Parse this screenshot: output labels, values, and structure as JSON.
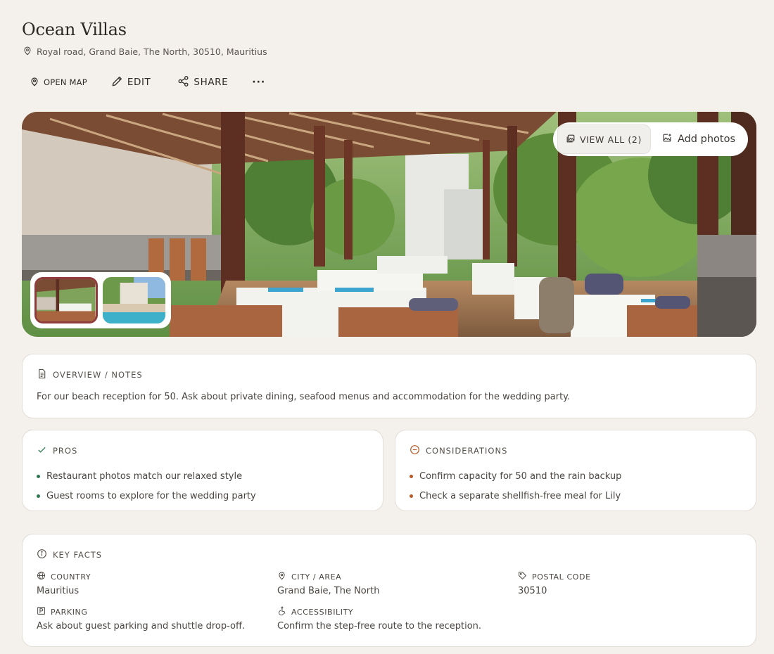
{
  "venue": {
    "title": "Ocean Villas",
    "address": "Royal road, Grand Baie, The North, 30510, Mauritius"
  },
  "actions": {
    "open_map": "OPEN MAP",
    "edit": "EDIT",
    "share": "SHARE",
    "more": "···"
  },
  "gallery": {
    "view_all": "VIEW ALL (2)",
    "add_photos": "Add photos",
    "photo_count": 2,
    "selected_thumbnail": 1
  },
  "overview": {
    "heading": "OVERVIEW / NOTES",
    "text": "For our beach reception for 50. Ask about private dining, seafood menus and accommodation for the wedding party."
  },
  "pros": {
    "heading": "PROS",
    "items": [
      "Restaurant photos match our relaxed style",
      "Guest rooms to explore for the wedding party"
    ]
  },
  "considerations": {
    "heading": "CONSIDERATIONS",
    "items": [
      "Confirm capacity for 50 and the rain backup",
      "Check a separate shellfish-free meal for Lily"
    ]
  },
  "key_facts": {
    "heading": "KEY FACTS",
    "country_label": "COUNTRY",
    "country": "Mauritius",
    "city_label": "CITY / AREA",
    "city": "Grand Baie, The North",
    "postal_label": "POSTAL CODE",
    "postal": "30510",
    "parking_label": "PARKING",
    "parking": "Ask about guest parking and shuttle drop-off.",
    "accessibility_label": "ACCESSIBILITY",
    "accessibility": "Confirm the step-free route to the reception."
  },
  "colors": {
    "background": "#f4f1ec",
    "pro_bullet": "#2f7a52",
    "consideration_bullet": "#b55a28",
    "selected_thumb_border": "#8f3b3b"
  }
}
